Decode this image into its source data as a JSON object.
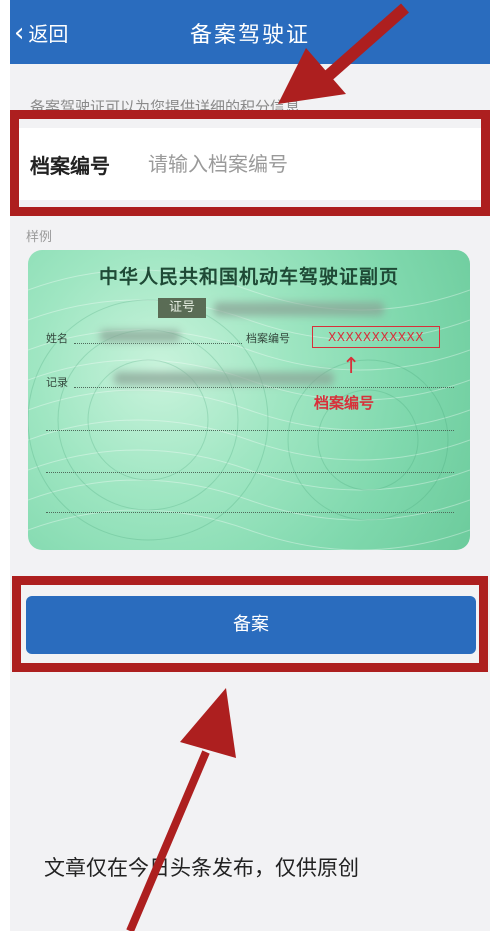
{
  "nav": {
    "back_label": "返回",
    "title": "备案驾驶证"
  },
  "hint": "备案驾驶证可以为您提供详细的积分信息",
  "form": {
    "label": "档案编号",
    "placeholder": "请输入档案编号",
    "value": ""
  },
  "sample_label": "样例",
  "card": {
    "title": "中华人民共和国机动车驾驶证副页",
    "cert_label": "证号",
    "name_label": "姓名",
    "archive_label": "档案编号",
    "record_label": "记录",
    "example_number": "XXXXXXXXXXX",
    "caption": "档案编号"
  },
  "button": {
    "label": "备案"
  },
  "footer": "文章仅在今日头条发布，仅供原创",
  "colors": {
    "primary": "#2a6cbe",
    "highlight": "#ad1f1f",
    "card_red": "#d8303a"
  }
}
